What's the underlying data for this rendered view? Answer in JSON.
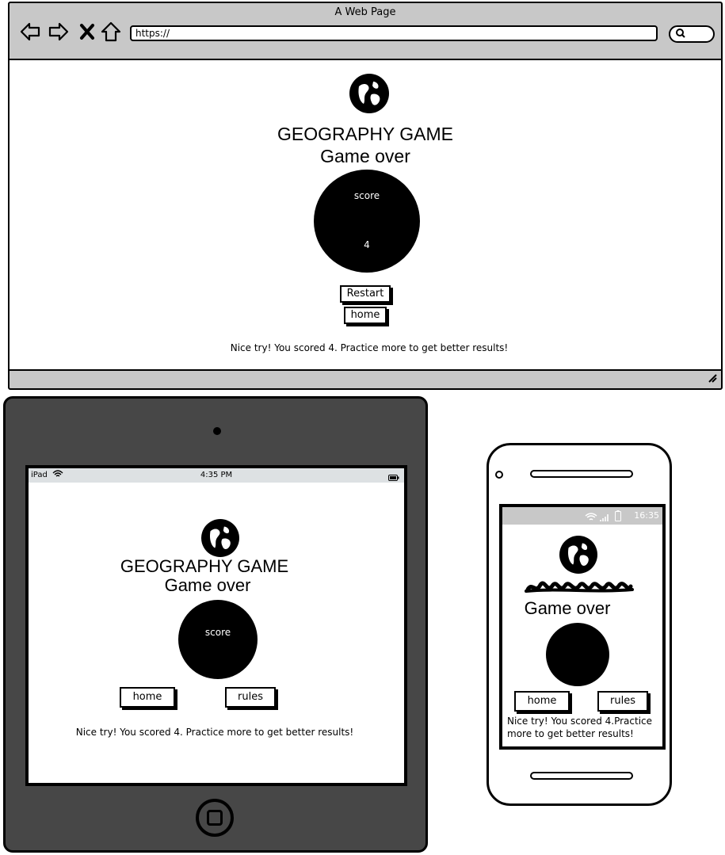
{
  "browser": {
    "window_title": "A Web Page",
    "url": "https://",
    "nav_icons": [
      "back-arrow-icon",
      "forward-arrow-icon",
      "close-x-icon",
      "home-icon"
    ],
    "app": {
      "title": "GEOGRAPHY GAME",
      "subtitle": "Game over",
      "score_label": "score",
      "score_value": "4",
      "restart_label": "Restart",
      "home_label": "home",
      "message": "Nice try! You scored 4. Practice more to get better results!"
    }
  },
  "tablet": {
    "status": {
      "device": "iPad",
      "time": "4:35 PM"
    },
    "app": {
      "title": "GEOGRAPHY GAME",
      "subtitle": "Game over",
      "score_label": "score",
      "home_label": "home",
      "rules_label": "rules",
      "message": "Nice try! You scored 4. Practice more to get better results!"
    }
  },
  "phone": {
    "status": {
      "time": "16:35"
    },
    "app": {
      "subtitle": "Game over",
      "home_label": "home",
      "rules_label": "rules",
      "message": "Nice try! You scored 4.Practice more to get better results!"
    }
  }
}
